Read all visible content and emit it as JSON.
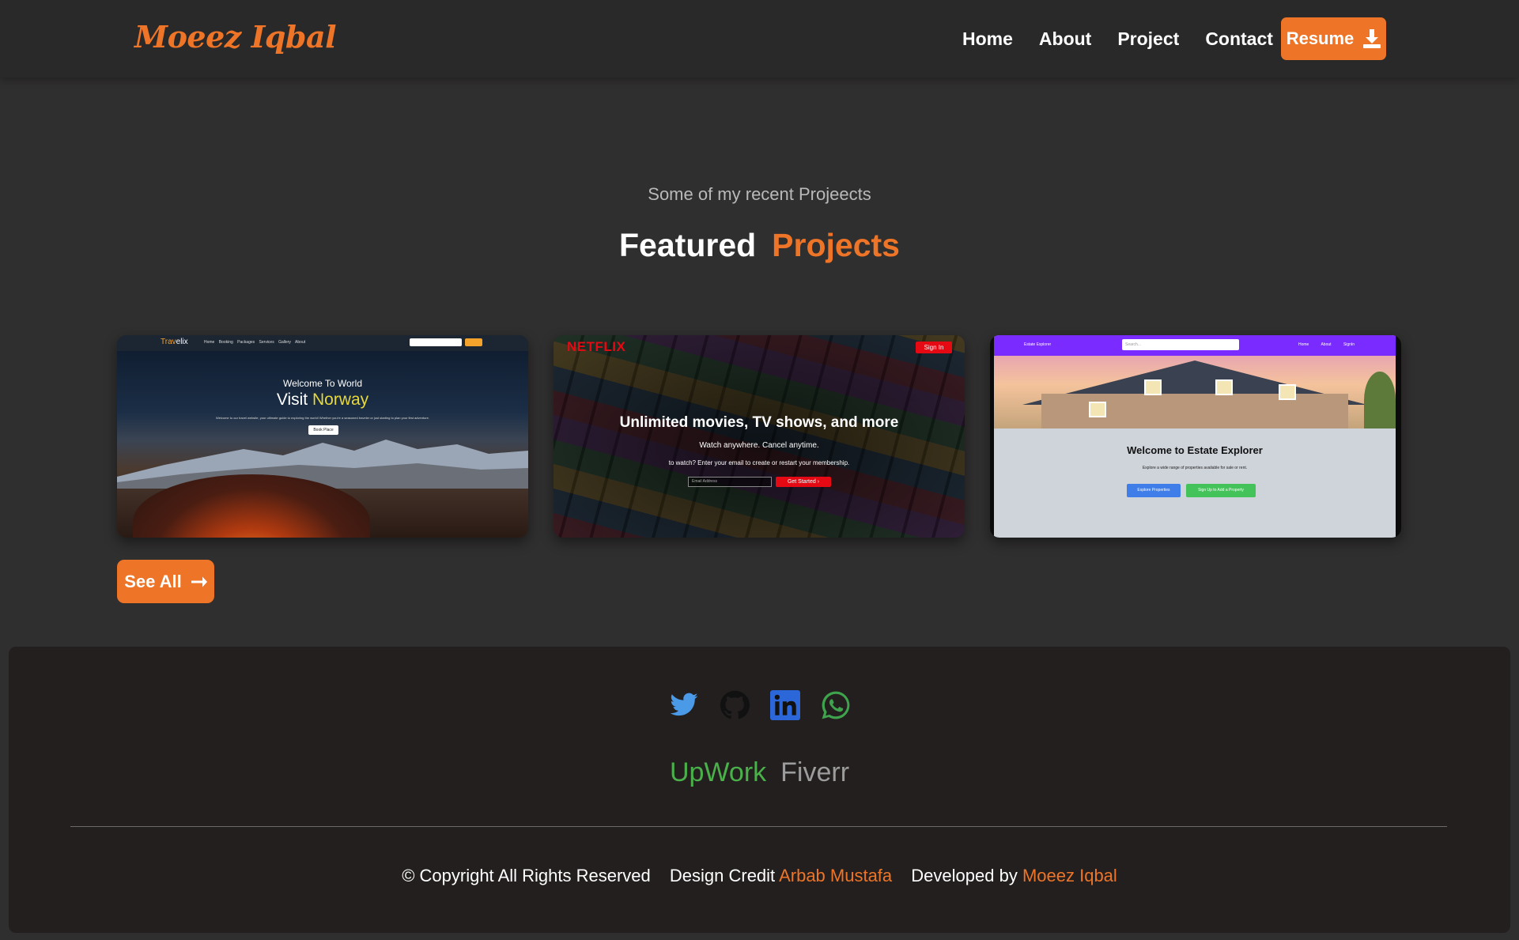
{
  "colors": {
    "accent": "#ee7527",
    "background": "#302f2f",
    "navbar_bg": "#2a2929",
    "footer_bg": "#231f1f",
    "upwork": "#4ab04a",
    "fiverr": "#9c9c9c"
  },
  "header": {
    "brand": "Moeez Iqbal",
    "nav": [
      "Home",
      "About",
      "Project",
      "Contact"
    ],
    "resume_label": "Resume",
    "resume_icon": "download-icon"
  },
  "projects_section": {
    "subtitle": "Some of my recent Projeects",
    "title_part1": "Featured",
    "title_part2": "Projects",
    "cards": [
      {
        "logo_a": "Trav",
        "logo_b": "elix",
        "menu": "Home Booking Packages Services Gallery About",
        "heading_small": "Welcome To World",
        "heading_main": "Visit",
        "heading_highlight": "Norway",
        "body": "Welcome to our travel website, your ultimate guide to exploring the world! Whether you're a seasoned traveler or just starting to plan your first adventure.",
        "button": "Book Place"
      },
      {
        "logo": "NETFLIX",
        "signin": "Sign In",
        "heading": "Unlimited movies, TV shows, and more",
        "line1": "Watch anywhere. Cancel anytime.",
        "line2": "to watch? Enter your email to create or restart your membership.",
        "input_placeholder": "Email Address",
        "button": "Get Started ›"
      },
      {
        "brand": "Estate Explorer",
        "search_placeholder": "Search...",
        "links": "Home About SignIn",
        "heading": "Welcome to Estate Explorer",
        "body": "Explore a wide range of properties available for sale or rent.",
        "button1": "Explore Properties",
        "button2": "Sign Up to Add a Property"
      }
    ],
    "see_all_label": "See All",
    "see_all_icon": "arrow-right-icon"
  },
  "footer": {
    "socials": [
      "twitter-icon",
      "github-icon",
      "linkedin-icon",
      "whatsapp-icon"
    ],
    "upwork": "UpWork",
    "fiverr": "Fiverr",
    "copyright": "© Copyright All Rights Reserved",
    "design_credit_label": "Design Credit",
    "design_credit_name": "Arbab Mustafa",
    "developed_by_label": "Developed by",
    "developed_by_name": "Moeez Iqbal"
  }
}
